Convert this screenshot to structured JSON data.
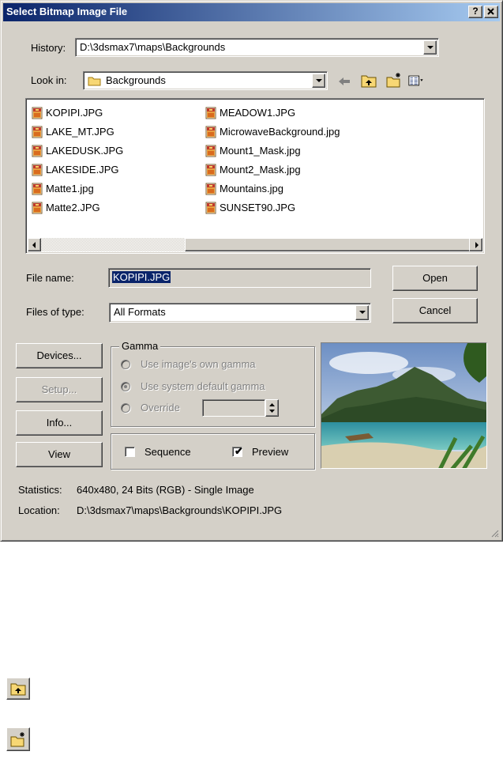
{
  "window": {
    "title": "Select Bitmap Image File",
    "help_button": "?",
    "close_button": "X"
  },
  "history": {
    "label": "History:",
    "value": "D:\\3dsmax7\\maps\\Backgrounds"
  },
  "lookin": {
    "label": "Look in:",
    "value": "Backgrounds",
    "icon": "folder-icon"
  },
  "toolbar": {
    "back_icon": "back-arrow-icon",
    "up_icon": "up-folder-icon",
    "new_folder_icon": "new-folder-icon",
    "view_menu_icon": "view-menu-icon"
  },
  "files": [
    {
      "name": "KOPIPI.JPG"
    },
    {
      "name": "LAKE_MT.JPG"
    },
    {
      "name": "LAKEDUSK.JPG"
    },
    {
      "name": "LAKESIDE.JPG"
    },
    {
      "name": "Matte1.jpg"
    },
    {
      "name": "Matte2.JPG"
    },
    {
      "name": "MEADOW1.JPG"
    },
    {
      "name": "MicrowaveBackground.jpg"
    },
    {
      "name": "Mount1_Mask.jpg"
    },
    {
      "name": "Mount2_Mask.jpg"
    },
    {
      "name": "Mountains.jpg"
    },
    {
      "name": "SUNSET90.JPG"
    }
  ],
  "filename": {
    "label": "File name:",
    "value": "KOPIPI.JPG"
  },
  "filetype": {
    "label": "Files of type:",
    "value": "All Formats"
  },
  "buttons": {
    "open": "Open",
    "cancel": "Cancel",
    "devices": "Devices...",
    "setup": "Setup...",
    "info": "Info...",
    "view": "View"
  },
  "gamma": {
    "title": "Gamma",
    "own": "Use image's own gamma",
    "system": "Use system default gamma",
    "override": "Override",
    "override_value": ""
  },
  "options": {
    "sequence": "Sequence",
    "sequence_checked": false,
    "preview": "Preview",
    "preview_checked": true
  },
  "statistics": {
    "label": "Statistics:",
    "value": "640x480, 24 Bits (RGB) - Single Image"
  },
  "location": {
    "label": "Location:",
    "value": "D:\\3dsmax7\\maps\\Backgrounds\\KOPIPI.JPG"
  },
  "colors": {
    "title_start": "#0a246a",
    "title_end": "#a6caf0",
    "face": "#d4d0c8",
    "selection": "#0a246a"
  },
  "extra_icons": [
    "up-folder-icon",
    "new-folder-icon"
  ]
}
